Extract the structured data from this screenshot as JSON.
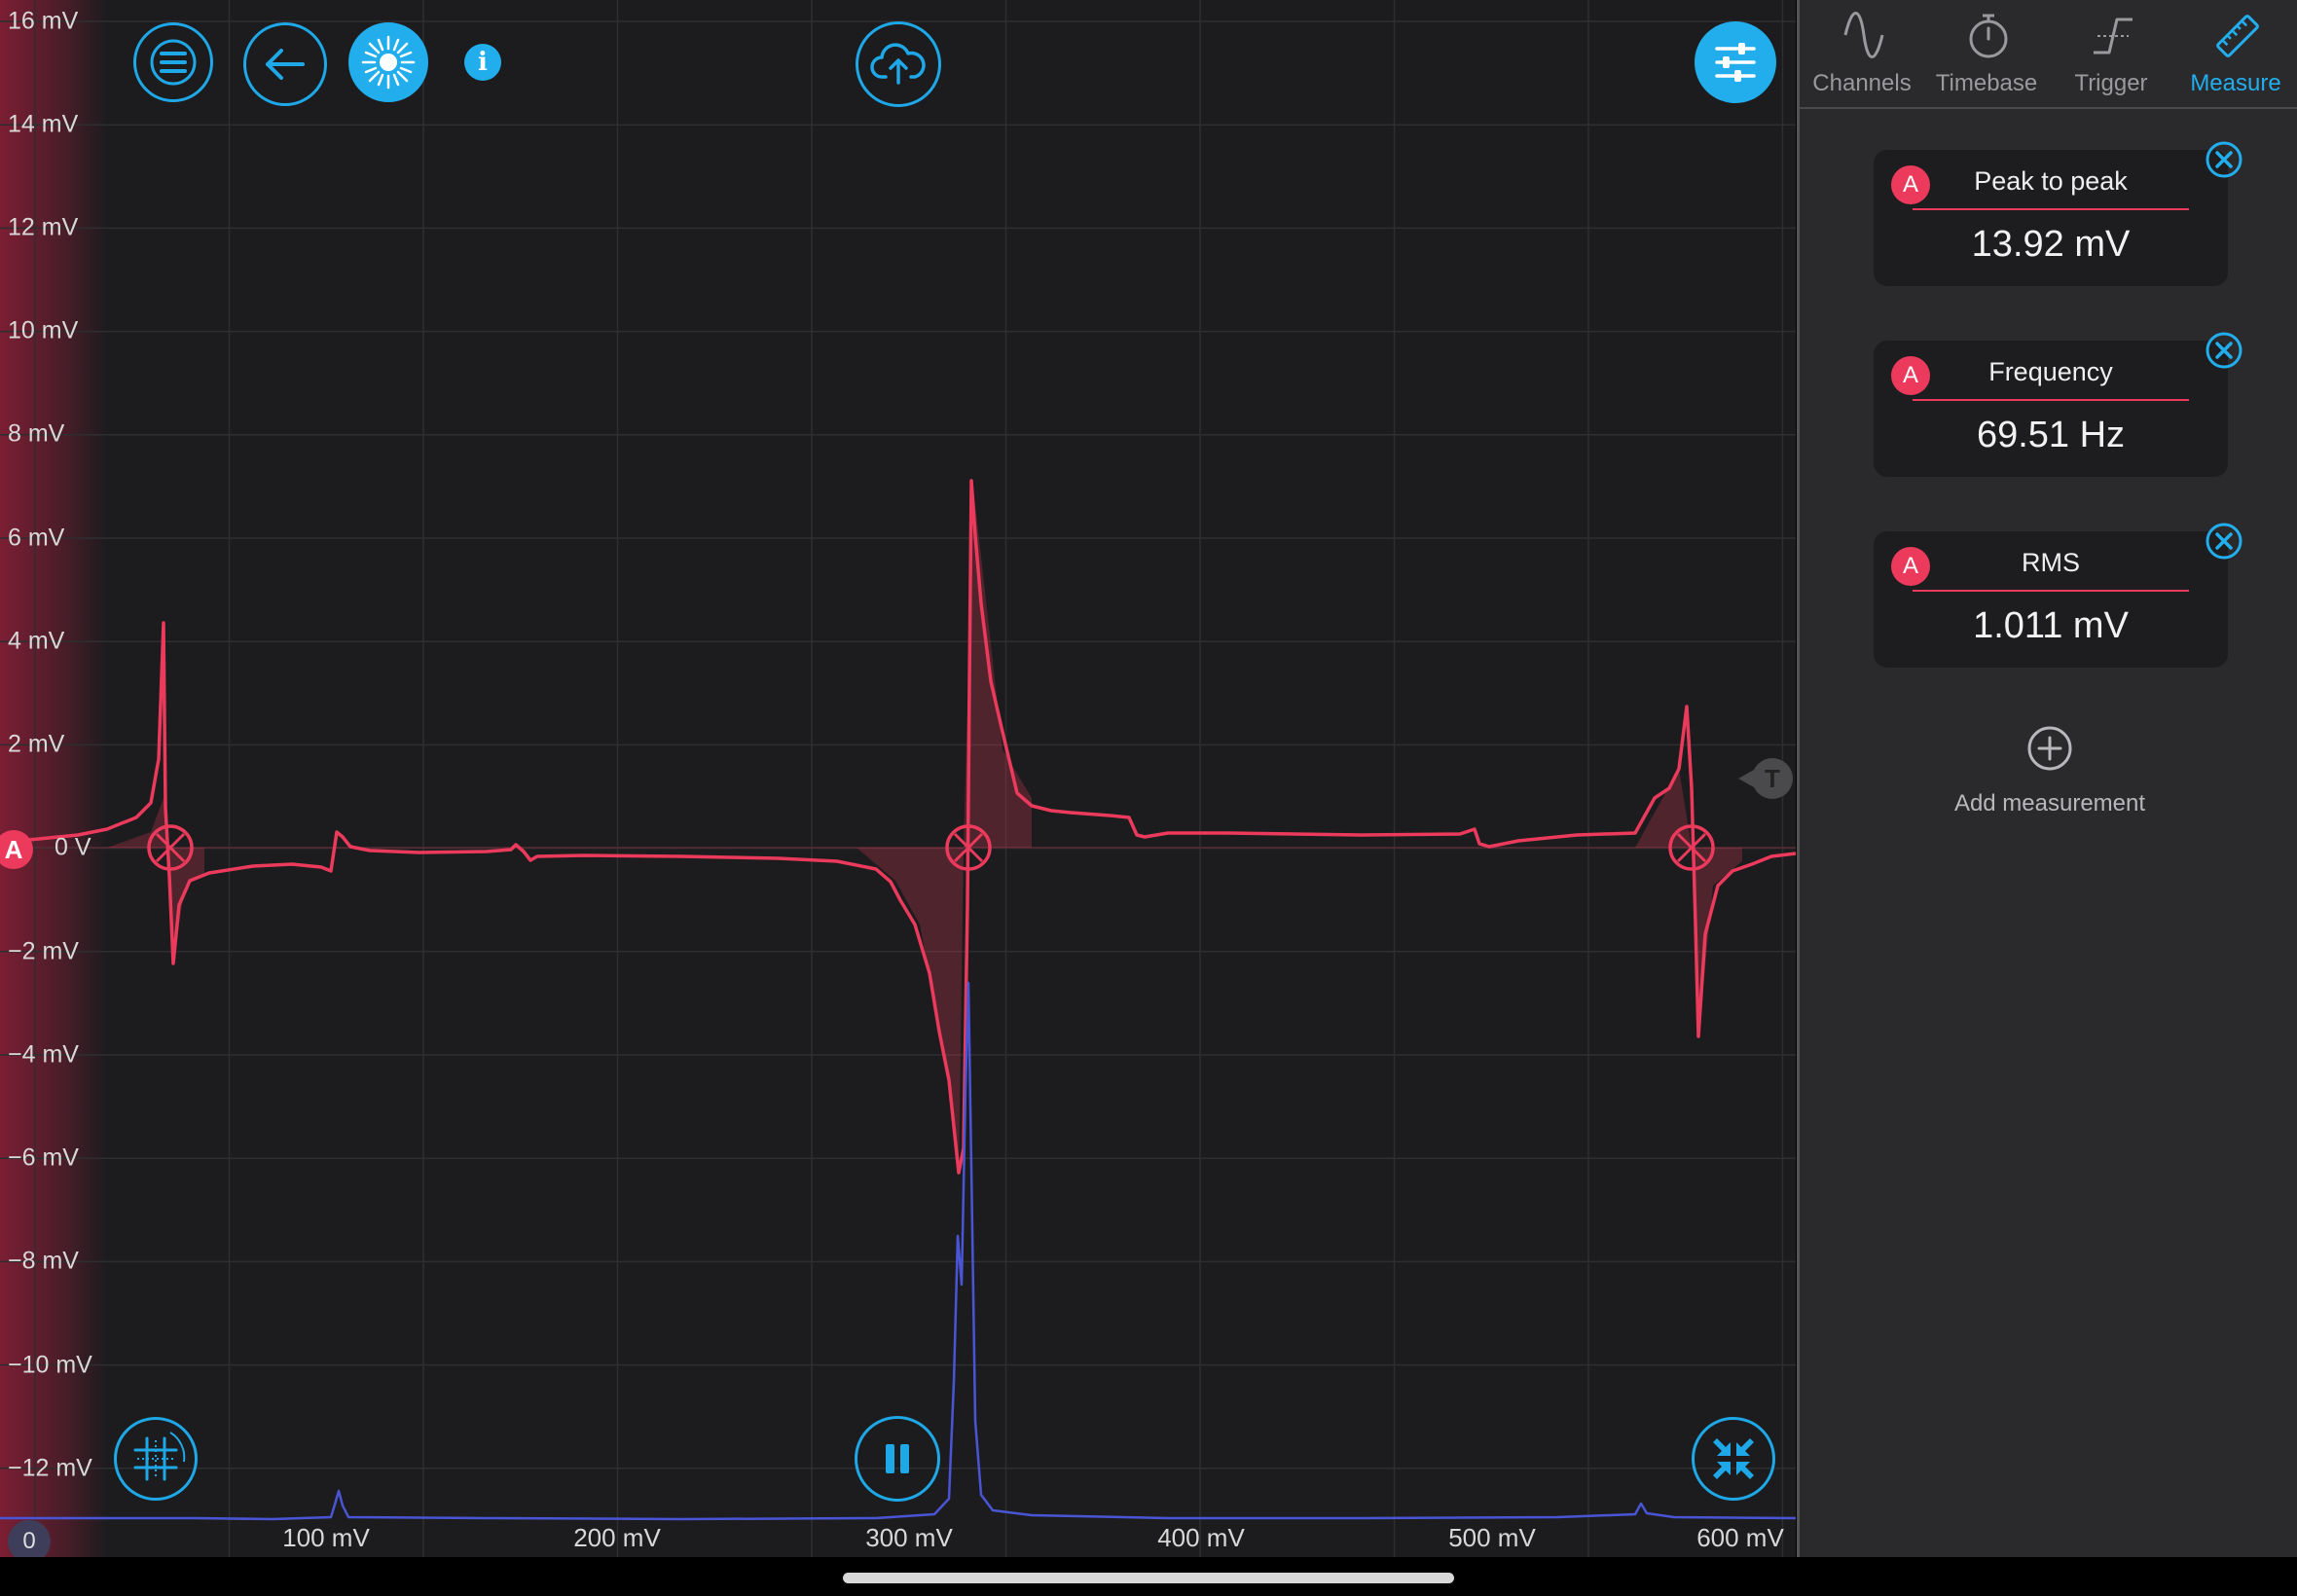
{
  "scope": {
    "y_axis_labels": [
      "16 mV",
      "14 mV",
      "12 mV",
      "10 mV",
      "8 mV",
      "6 mV",
      "4 mV",
      "2 mV",
      "0 V",
      "−2 mV",
      "−4 mV",
      "−6 mV",
      "−8 mV",
      "−10 mV",
      "−12 mV"
    ],
    "x_axis_labels": [
      "100 mV",
      "200 mV",
      "300 mV",
      "400 mV",
      "500 mV",
      "600 mV"
    ],
    "channel_marker": "A",
    "trigger_marker": "T",
    "zero_badge": "0",
    "trace_color_channel_a": "#ec3a5c",
    "trace_color_secondary": "#4a55d6"
  },
  "toolbar": {
    "menu_icon": "hamburger-menu-icon",
    "back_icon": "arrow-left-icon",
    "brightness_icon": "sun-burst-icon",
    "info_label": "i",
    "upload_icon": "cloud-upload-icon",
    "settings_icon": "sliders-icon",
    "grid_icon": "grid-crosshair-icon",
    "pause_icon": "pause-icon",
    "collapse_icon": "compress-arrows-icon"
  },
  "panel": {
    "tabs": [
      {
        "label": "Channels",
        "icon": "sine-wave-icon"
      },
      {
        "label": "Timebase",
        "icon": "stopwatch-icon"
      },
      {
        "label": "Trigger",
        "icon": "trigger-edge-icon"
      },
      {
        "label": "Measure",
        "icon": "ruler-icon",
        "active": true
      }
    ],
    "measurements": [
      {
        "channel": "A",
        "name": "Peak to peak",
        "value": "13.92 mV"
      },
      {
        "channel": "A",
        "name": "Frequency",
        "value": "69.51 Hz"
      },
      {
        "channel": "A",
        "name": "RMS",
        "value": "1.011 mV"
      }
    ],
    "add_label": "Add measurement"
  },
  "colors": {
    "accent": "#22aeed",
    "channel_a": "#ec3a5c",
    "panel_bg": "#2a2a2c",
    "plot_bg": "#1c1c1e"
  }
}
